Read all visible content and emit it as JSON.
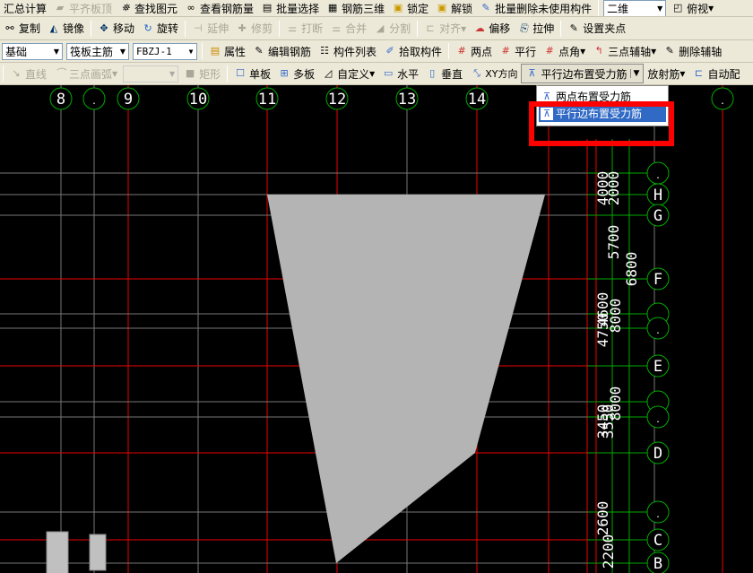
{
  "toolbar1": [
    "汇总计算",
    "平齐板顶",
    "查找图元",
    "查看钢筋量",
    "批量选择",
    "钢筋三维",
    "锁定",
    "解锁",
    "批量删除未使用构件",
    "二维",
    "俯视"
  ],
  "toolbar2": [
    "复制",
    "镜像",
    "移动",
    "旋转",
    "延伸",
    "修剪",
    "打断",
    "合并",
    "分割",
    "对齐",
    "偏移",
    "拉伸",
    "设置夹点"
  ],
  "toolbar3": {
    "selects": [
      "基础",
      "筏板主筋",
      "FBZJ-1"
    ],
    "buttons": [
      "属性",
      "编辑钢筋",
      "构件列表",
      "拾取构件",
      "两点",
      "平行",
      "点角",
      "三点辅轴",
      "删除辅轴"
    ]
  },
  "toolbar4": [
    "直线",
    "三点画弧",
    "矩形",
    "单板",
    "多板",
    "自定义",
    "水平",
    "垂直",
    "XY方向",
    "平行边布置受力筋",
    "放射筋",
    "自动配"
  ],
  "dropdown": {
    "items": [
      "两点布置受力筋",
      "平行边布置受力筋"
    ],
    "selected": 1
  },
  "axes_top": [
    "8",
    ".",
    "9",
    "10",
    "11",
    "12",
    "13",
    "14",
    ".",
    "."
  ],
  "axes_right": [
    ".",
    "H",
    "G",
    "F",
    ".",
    ".",
    "E",
    ".",
    ".",
    "D",
    ".",
    "C",
    "B"
  ],
  "dims": [
    "4000",
    "2000",
    "5700",
    "6800",
    "4750",
    "4600",
    "8000",
    "3450",
    "3550",
    "8000",
    "2600",
    "2200"
  ],
  "colors": {
    "accent": "#316ac5",
    "highlight": "#ff0000",
    "slab": "#b4b4b4"
  }
}
